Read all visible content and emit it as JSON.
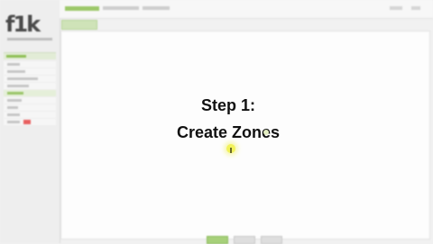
{
  "app": {
    "logo_text": "f1k",
    "colors": {
      "accent": "#9cc869",
      "alert": "#e86060"
    }
  },
  "sidebar": {
    "items": [
      {
        "name": "nav-item-1",
        "active": false
      },
      {
        "name": "nav-item-2",
        "active": false
      },
      {
        "name": "nav-item-3",
        "active": false
      },
      {
        "name": "nav-item-4",
        "active": false
      },
      {
        "name": "nav-item-5",
        "active": true
      },
      {
        "name": "nav-item-6",
        "active": false
      },
      {
        "name": "nav-item-7",
        "active": false
      },
      {
        "name": "nav-item-8",
        "active": false
      },
      {
        "name": "nav-item-9",
        "active": false,
        "alert": true
      }
    ]
  },
  "overlay": {
    "line1": "Step 1:",
    "line2": "Create Zones"
  }
}
